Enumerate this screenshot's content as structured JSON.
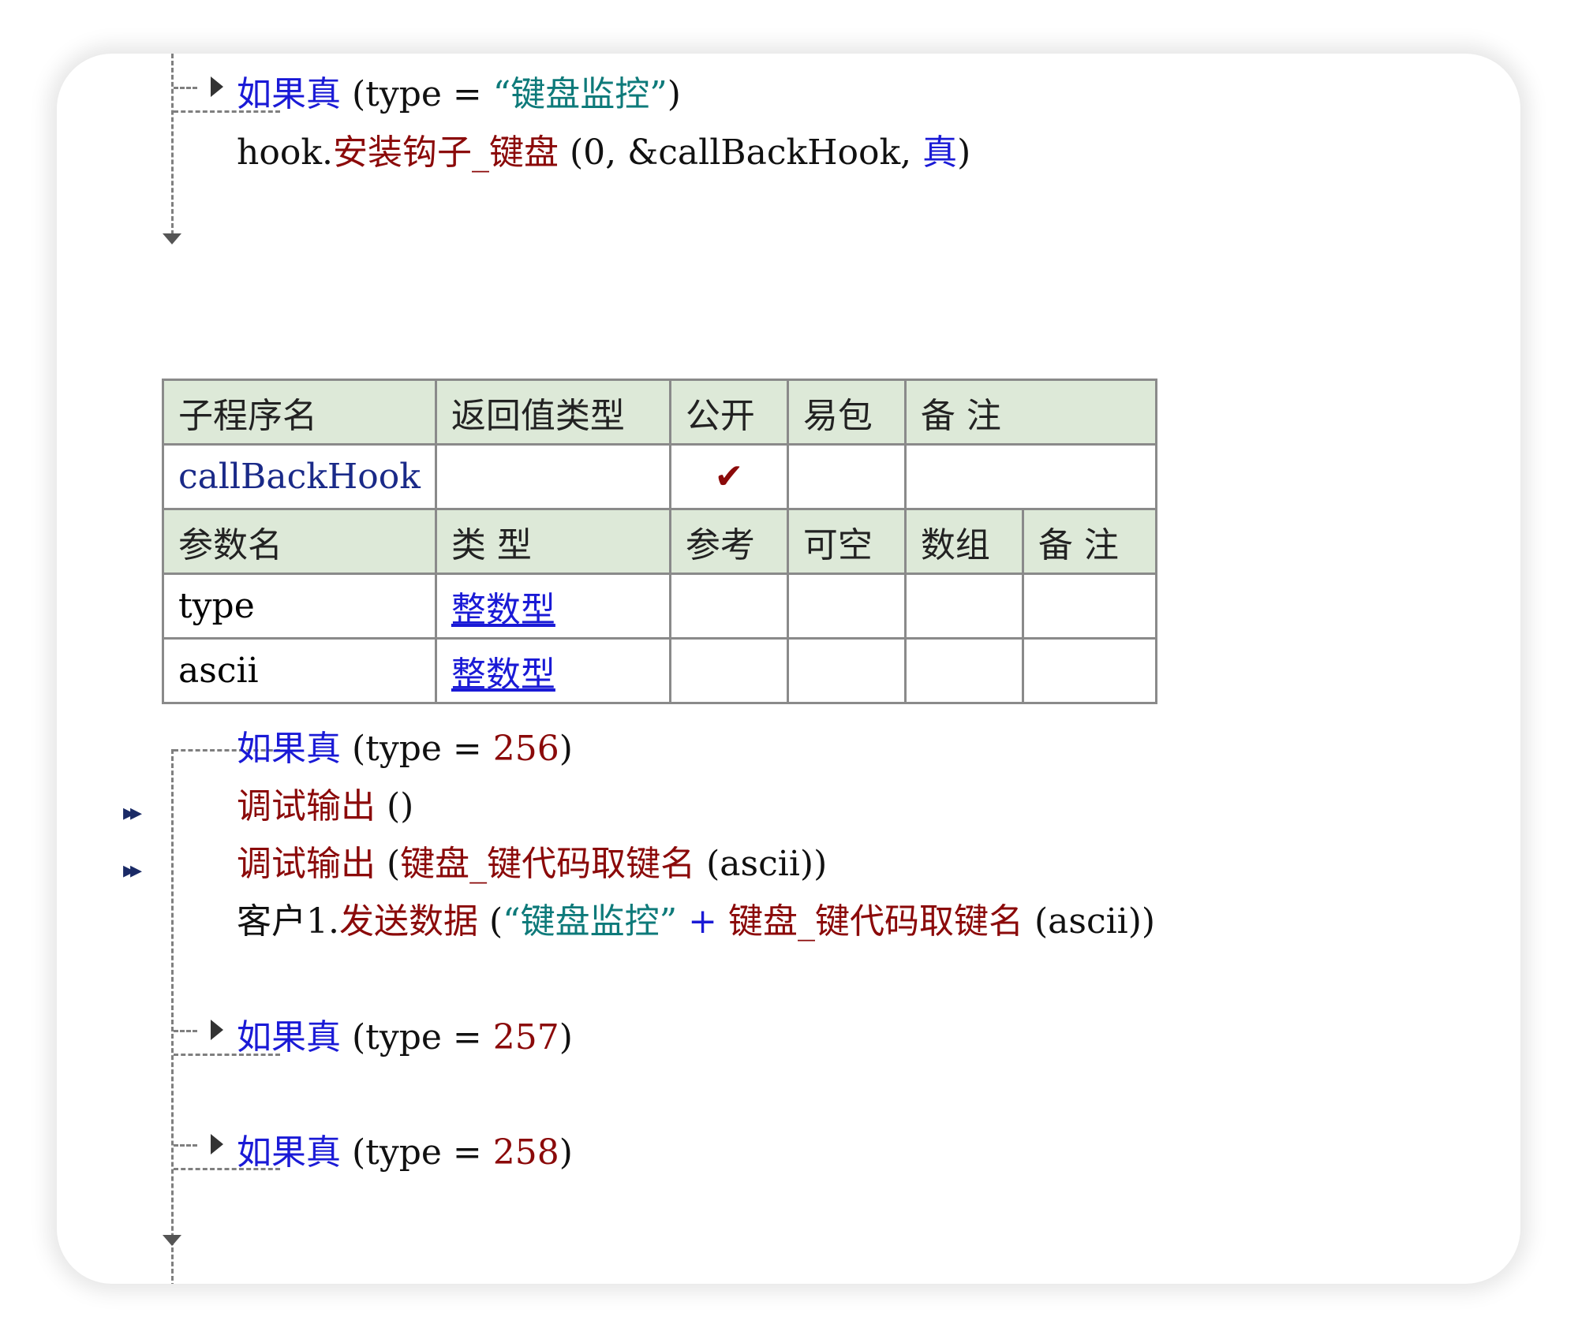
{
  "top_block": {
    "if_keyword": "如果真",
    "if_open": " (type = ",
    "if_string": "“键盘监控”",
    "if_close": ")",
    "hook_obj": "hook.",
    "hook_method": "安装钩子_键盘",
    "hook_args": " (0, &callBackHook, ",
    "hook_true": "真",
    "hook_close": ")"
  },
  "table": {
    "header1": [
      "子程序名",
      "返回值类型",
      "公开",
      "易包",
      "备 注"
    ],
    "row1": {
      "name": "callBackHook",
      "return_type": "",
      "public_mark": "✔",
      "epkg": "",
      "remark": ""
    },
    "header2": [
      "参数名",
      "类 型",
      "参考",
      "可空",
      "数组",
      "备 注"
    ],
    "params": [
      {
        "name": "type",
        "type": "整数型",
        "ref": "",
        "nullable": "",
        "array": "",
        "remark": ""
      },
      {
        "name": "ascii",
        "type": "整数型",
        "ref": "",
        "nullable": "",
        "array": "",
        "remark": ""
      }
    ]
  },
  "bottom_block": {
    "if1_keyword": "如果真",
    "if1_cond": " (type = ",
    "if1_value": "256",
    "if1_close": ")",
    "debug1_fn": "调试输出",
    "debug1_args": " ()",
    "debug2_fn": "调试输出",
    "debug2_open": " (",
    "debug2_inner_fn": "键盘_键代码取键名",
    "debug2_args": " (ascii))",
    "send_obj": "客户1.",
    "send_fn": "发送数据",
    "send_open": " (",
    "send_string": "“键盘监控”",
    "send_plus": " + ",
    "send_inner_fn": "键盘_键代码取键名",
    "send_args": " (ascii))",
    "if2_keyword": "如果真",
    "if2_cond": " (type = ",
    "if2_value": "257",
    "if2_close": ")",
    "if3_keyword": "如果真",
    "if3_cond": " (type = ",
    "if3_value": "258",
    "if3_close": ")"
  },
  "breakpoint_icon": "double-arrow-breakpoint",
  "colors": {
    "keyword": "#1a1ad6",
    "function": "#8b0a0a",
    "string": "#0e7a7a",
    "header_bg": "#dde9d8"
  }
}
